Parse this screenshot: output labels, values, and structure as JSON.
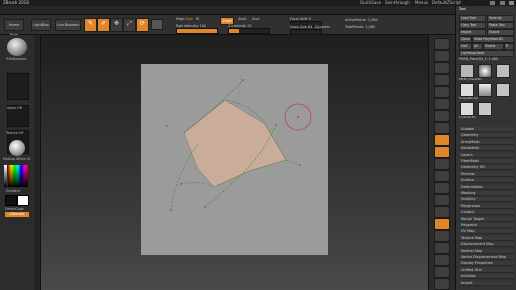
{
  "titlebar": {
    "title": "ZBrush 2018",
    "right_items": [
      "QuickSave",
      "See-through",
      "Menus",
      "DefaultZScript"
    ]
  },
  "menubar": {
    "items": [
      "Alpha",
      "Brush",
      "Color",
      "Document",
      "Draw",
      "Edit",
      "File",
      "Layer",
      "Light",
      "Macro",
      "Marker",
      "Material",
      "Movie",
      "Picker",
      "Preferences",
      "Render",
      "Stencil",
      "Stroke",
      "Texture",
      "Tool",
      "Transform",
      "Zplugin",
      "Zscript"
    ]
  },
  "toolbar": {
    "home_page": "Home Page",
    "lightbox": "LightBox",
    "live_boolean": "Live Boolean",
    "mrgb": "Mrgb",
    "rgb": "Rgb",
    "m": "M",
    "zadd": "Zadd",
    "zsub": "Zsub",
    "zcut": "Zcut",
    "rgb_intensity": "Rgb Intensity 100",
    "z_intensity": "Z Intensity 25",
    "focal_shift": "Focal Shift 0",
    "draw_size": "Draw Size 64",
    "dynamic": "Dynamic",
    "active_points": "ActivePoints: 1,080",
    "total_points": "TotalPoints: 1,080",
    "rgb_fill": 1.0,
    "z_fill": 0.25
  },
  "leftpanel": {
    "brush_label": "TrimDynamic",
    "alpha_label": "Alpha Off",
    "texture_label": "Texture Off",
    "material_label": "MatCap White 01",
    "gradient_label": "Gradient",
    "switch_color": "SwitchColor",
    "alternate": "Alternate"
  },
  "rightpanel": {
    "header": "Tool",
    "load_tool": "Load Tool",
    "save_as": "Save As",
    "copy_tool": "Copy Tool",
    "paste_tool": "Paste Tool",
    "import": "Import",
    "export": "Export",
    "clone": "Clone",
    "make_polymesh": "Make PolyMesh3D",
    "goz": "GoZ",
    "all": "All",
    "visible": "Visible",
    "r": "R",
    "lightbox_tools": "Lightbox▸Tools",
    "current_tool": "PM3D_Plane3D_1: 1,080",
    "tools": [
      "PM3D_Plane3D",
      "SimpleBrush",
      "Cylinder3D",
      "PM3D_Plane3D"
    ],
    "subtool_items": [
      "Subtool",
      "Geometry",
      "ArrayMesh",
      "NanoMesh",
      "Layers",
      "FiberMesh",
      "Geometry HD",
      "Preview",
      "Surface",
      "Deformation",
      "Masking",
      "Visibility",
      "Polygroups",
      "Contact",
      "Morph Target",
      "Polypaint",
      "UV Map",
      "Texture Map",
      "Displacement Map",
      "Normal Map",
      "Vector Displacement Map",
      "Display Properties",
      "Unified Skin",
      "Initialize",
      "Import"
    ]
  },
  "rightstrip": {
    "icons": [
      "bpr-icon",
      "spix-icon",
      "scroll-icon",
      "zoom-icon",
      "actual-icon",
      "aahalf-icon",
      "persp-icon",
      "floor-icon",
      "local-icon",
      "lsym-icon",
      "xyz-icon",
      "frame-icon",
      "move-icon",
      "scale-icon",
      "rotate-icon",
      "linefill-icon",
      "polyf-icon",
      "transp-icon",
      "ghost-icon",
      "solo-icon",
      "xpose-icon"
    ]
  },
  "colors": {
    "accent": "#e0862a",
    "shape_fill": "#c9ad9a",
    "guide_green": "#3b8a3b",
    "guide_red": "#c0394f",
    "doc": "#9b9b9b"
  }
}
